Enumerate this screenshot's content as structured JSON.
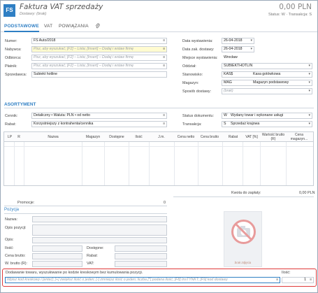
{
  "header": {
    "badge": "FS",
    "title": "Faktura VAT sprzedaży",
    "subtitle": "Dostawy: (brak)",
    "amount": "0,00 PLN",
    "status_line": "Status: W · Transakcja: S"
  },
  "tabs": [
    {
      "label": "PODSTAWOWE",
      "active": true
    },
    {
      "label": "VAT",
      "active": false
    },
    {
      "label": "POWIĄZANIA",
      "active": false
    }
  ],
  "icons": {
    "attachment": "paperclip-icon",
    "lookup": "≡",
    "dropdown": "▾"
  },
  "form_left": {
    "number_label": "Numer:",
    "number_value": "FS Auto/2018",
    "buyer_label": "Nabywca:",
    "buyer_placeholder": "Pisz, aby wyszukać; [F2] – Lista; [Insert] – Dodaj i wstaw firmę",
    "recipient_label": "Odbiorca:",
    "recipient_placeholder": "Pisz, aby wyszukać; [F2] – Lista; [Insert] – Dodaj i wstaw firmę",
    "payer_label": "Płatnik:",
    "payer_placeholder": "Pisz, aby wyszukać; [F2] – Lista; [Insert] – Dodaj i wstaw firmę",
    "seller_label": "Sprzedawca:",
    "seller_value": "Subiekt hotline"
  },
  "form_right": {
    "issue_date_label": "Data wystawienia:",
    "issue_date": "26-04-2018",
    "delivery_date_label": "Data zak. dostawy:",
    "delivery_date": "26-04-2018",
    "place_label": "Miejsce wystawienia:",
    "place": "Wrocław",
    "branch_label": "Oddział:",
    "branch": "SUBIEKTHOTLIN",
    "station_label": "Stanowisko:",
    "station_code": "KAS$",
    "station_name": "Kasa gotówkowa",
    "warehouse_label": "Magazyn:",
    "warehouse_code": "MAG",
    "warehouse_name": "Magazyn podstawowy",
    "delivery_label": "Sposób dostawy:",
    "delivery_value": "(brak)"
  },
  "assortment": {
    "section": "ASORTYMENT",
    "pricelist_label": "Cennik:",
    "pricelist_value": "Detaliczny • Waluta: PLN • od netto",
    "discount_label": "Rabat:",
    "discount_value": "Korzystniejszy z kontrahenta/cennika",
    "doc_status_label": "Status dokumentu:",
    "doc_status_code": "W",
    "doc_status_value": "Wydany towar i wykonane usługi",
    "transaction_label": "Transakcja:",
    "transaction_code": "S",
    "transaction_value": "Sprzedaż krajowa"
  },
  "grid": {
    "columns": [
      "LP",
      "R",
      "Nazwa",
      "Magazyn",
      "Dostępne",
      "Ilość",
      "J.m.",
      "Cena netto",
      "Cena brutto",
      "Rabat",
      "VAT [%]",
      "Wartość brutto (R)",
      "Cena magazyn..."
    ]
  },
  "totals": {
    "to_pay_label": "Kwota do zapłaty:",
    "to_pay_value": "0,00 PLN",
    "promo_label": "Promocje:",
    "promo_value": "0"
  },
  "position": {
    "section": "Pozycja",
    "name_label": "Nazwa:",
    "desc_label": "Opis pozycji:",
    "opis_label": "Opis:",
    "qty_label": "Ilość:",
    "available_label": "Dostępne:",
    "gross_label": "Cena brutto:",
    "discount_label": "Rabat:",
    "value_label": "W. brutto (R):",
    "vat_label": "VAT:",
    "image_caption": "brak zdjęcia"
  },
  "barcode": {
    "title": "Dodawanie towaru, wyszukiwanie po kodzie kreskowym bez kumulowania pozycji.",
    "input_placeholder": "Wpisz kod kreskowy i [enter]; [+] zwiększ ilość o jeden; [-] zmniejsz ilość o jeden; liczba [*] podana ilość; [F8] InsTYNKT; [F9] kod dostawy",
    "qty_label": "Ilość:",
    "qty_value": "1"
  },
  "colors": {
    "accent": "#2f7fc4",
    "highlight": "#e03a3a",
    "yellow_field": "#fffbd0"
  }
}
